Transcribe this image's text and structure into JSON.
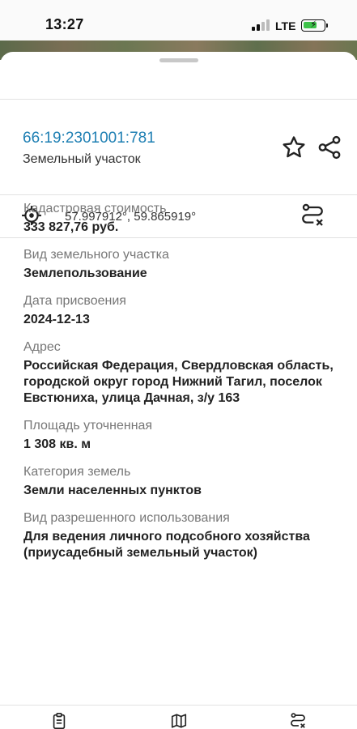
{
  "status_bar": {
    "time": "13:27",
    "network": "LTE",
    "signal_bars_filled": 2,
    "signal_bars_total": 4
  },
  "object": {
    "cadastral_number": "66:19:2301001:781",
    "type": "Земельный участок",
    "coordinates": "57.997912°, 59.865919°"
  },
  "properties": [
    {
      "label": "Кадастровая стоимость",
      "value": "333 827,76 руб."
    },
    {
      "label": "Вид земельного участка",
      "value": "Землепользование"
    },
    {
      "label": "Дата присвоения",
      "value": "2024-12-13"
    },
    {
      "label": "Адрес",
      "value": "Российская Федерация, Свердловская область, городской округ город Нижний Тагил, поселок Евстюниха, улица Дачная, з/у 163"
    },
    {
      "label": "Площадь уточненная",
      "value": "1 308 кв. м"
    },
    {
      "label": "Категория земель",
      "value": "Земли населенных пунктов"
    },
    {
      "label": "Вид разрешенного использования",
      "value": "Для ведения личного подсобного хозяйства (приусадебный земельный участок)"
    }
  ],
  "icons": {
    "favorite": "star-icon",
    "share": "share-icon",
    "location": "gps-target-icon",
    "route": "route-icon",
    "tabs": [
      "clipboard-icon",
      "map-icon",
      "route-icon"
    ]
  },
  "colors": {
    "accent": "#1e7fb3",
    "battery": "#3ec24a"
  }
}
